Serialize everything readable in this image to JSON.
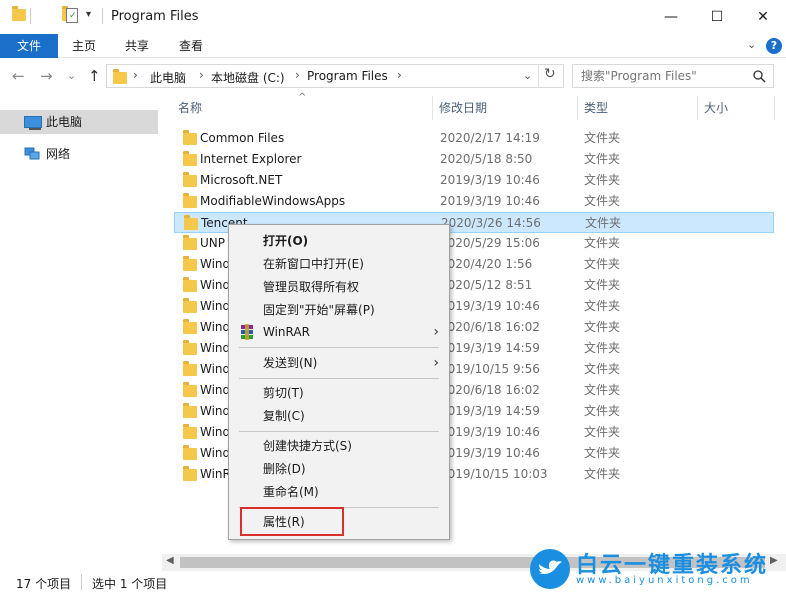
{
  "window": {
    "title": "Program Files",
    "minimize": "—",
    "maximize": "☐",
    "close": "✕"
  },
  "ribbon": {
    "tabs": [
      "文件",
      "主页",
      "共享",
      "查看"
    ],
    "expand": "⌄",
    "help": "?"
  },
  "address": {
    "back": "←",
    "forward": "→",
    "recent": "⌄",
    "up": "↑",
    "crumbs": [
      "此电脑",
      "本地磁盘 (C:)",
      "Program Files"
    ],
    "dropdown": "⌄",
    "refresh": "↻",
    "search_placeholder": "搜索\"Program Files\""
  },
  "navpane": {
    "items": [
      "此电脑",
      "网络"
    ]
  },
  "columns": {
    "name": "名称",
    "date": "修改日期",
    "type": "类型",
    "size": "大小",
    "sort_arrow": "^"
  },
  "files": [
    {
      "name": "Common Files",
      "date": "2020/2/17 14:19",
      "type": "文件夹"
    },
    {
      "name": "Internet Explorer",
      "date": "2020/5/18 8:50",
      "type": "文件夹"
    },
    {
      "name": "Microsoft.NET",
      "date": "2019/3/19 10:46",
      "type": "文件夹"
    },
    {
      "name": "ModifiableWindowsApps",
      "date": "2019/3/19 10:46",
      "type": "文件夹"
    },
    {
      "name": "Tencent",
      "date": "2020/3/26 14:56",
      "type": "文件夹",
      "selected": true
    },
    {
      "name": "UNP",
      "date": "2020/5/29 15:06",
      "type": "文件夹"
    },
    {
      "name": "Wind",
      "date": "2020/4/20 1:56",
      "type": "文件夹"
    },
    {
      "name": "Wind",
      "date": "2020/5/12 8:51",
      "type": "文件夹"
    },
    {
      "name": "Wind",
      "date": "2019/3/19 10:46",
      "type": "文件夹"
    },
    {
      "name": "Wind",
      "date": "2020/6/18 16:02",
      "type": "文件夹"
    },
    {
      "name": "Wind",
      "date": "2019/3/19 14:59",
      "type": "文件夹"
    },
    {
      "name": "Wind",
      "date": "2019/10/15 9:56",
      "type": "文件夹"
    },
    {
      "name": "Wind",
      "date": "2020/6/18 16:02",
      "type": "文件夹"
    },
    {
      "name": "Wind",
      "date": "2019/3/19 14:59",
      "type": "文件夹"
    },
    {
      "name": "Wind",
      "date": "2019/3/19 10:46",
      "type": "文件夹"
    },
    {
      "name": "Wind",
      "date": "2019/3/19 10:46",
      "type": "文件夹"
    },
    {
      "name": "WinR",
      "date": "2019/10/15 10:03",
      "type": "文件夹"
    }
  ],
  "context_menu": {
    "open": "打开(O)",
    "open_new_window": "在新窗口中打开(E)",
    "take_ownership": "管理员取得所有权",
    "pin_start": "固定到\"开始\"屏幕(P)",
    "winrar": "WinRAR",
    "send_to": "发送到(N)",
    "cut": "剪切(T)",
    "copy": "复制(C)",
    "create_shortcut": "创建快捷方式(S)",
    "delete": "删除(D)",
    "rename": "重命名(M)",
    "properties": "属性(R)",
    "submenu_arrow": "›"
  },
  "statusbar": {
    "item_count": "17 个项目",
    "selected": "选中 1 个项目"
  },
  "scrollbar": {
    "left": "◀",
    "right": "▶"
  },
  "watermark": {
    "title": "白云一键重装系统",
    "url": "www.baiyunxitong.com"
  },
  "colors": {
    "accent": "#1a6fc9",
    "selection": "#cce8ff",
    "highlight": "#d9302b",
    "folder": "#f5c84c"
  }
}
